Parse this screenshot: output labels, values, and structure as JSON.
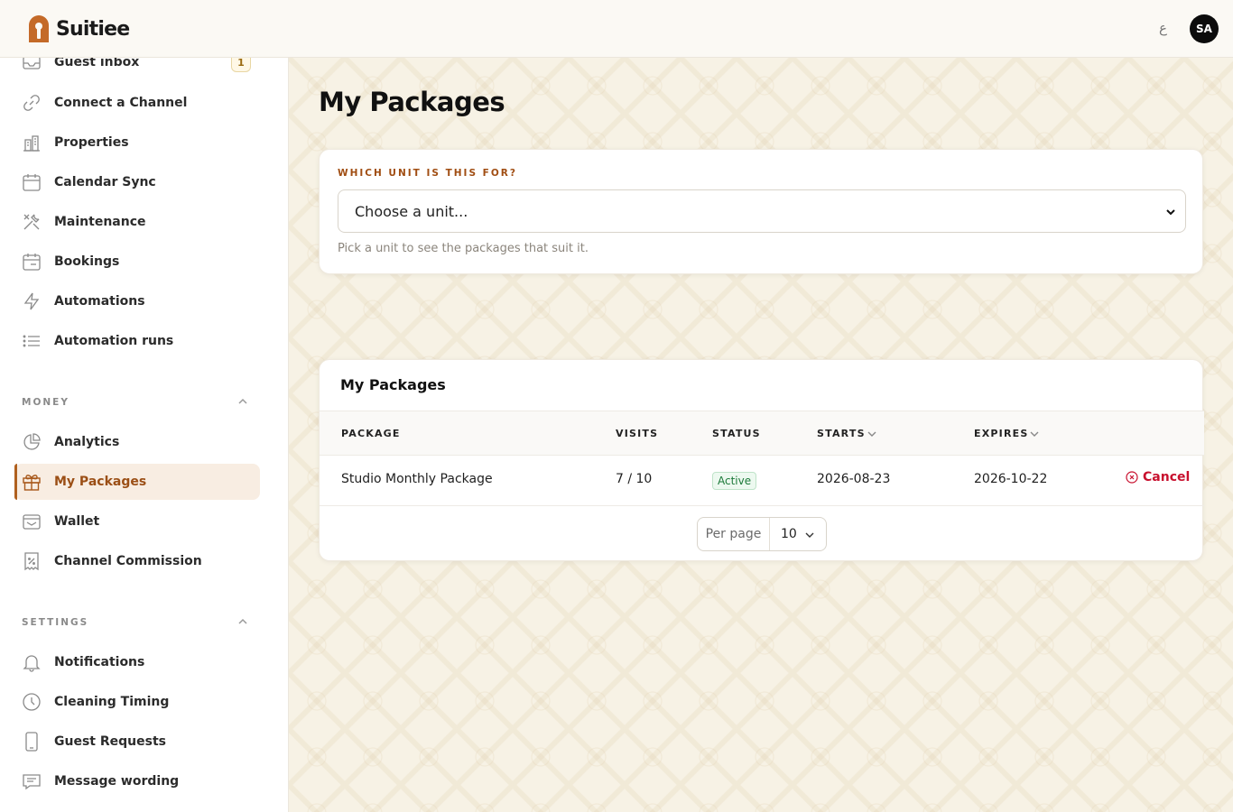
{
  "app": {
    "name": "Suitiee"
  },
  "header": {
    "lang_toggle": "ع",
    "avatar_initials": "SA"
  },
  "sidebar": {
    "items": [
      {
        "label": "Guest inbox",
        "icon": "inbox-icon",
        "badge": "1"
      },
      {
        "label": "Connect a Channel",
        "icon": "link-icon"
      },
      {
        "label": "Properties",
        "icon": "building-icon"
      },
      {
        "label": "Calendar Sync",
        "icon": "calendar-icon"
      },
      {
        "label": "Maintenance",
        "icon": "tools-icon"
      },
      {
        "label": "Bookings",
        "icon": "calendar-icon"
      },
      {
        "label": "Automations",
        "icon": "bolt-icon"
      },
      {
        "label": "Automation runs",
        "icon": "list-icon"
      }
    ],
    "money_section": {
      "title": "MONEY",
      "items": [
        {
          "label": "Analytics",
          "icon": "pie-chart-icon"
        },
        {
          "label": "My Packages",
          "icon": "gift-icon",
          "active": true
        },
        {
          "label": "Wallet",
          "icon": "wallet-icon"
        },
        {
          "label": "Channel Commission",
          "icon": "receipt-icon"
        }
      ]
    },
    "settings_section": {
      "title": "SETTINGS",
      "items": [
        {
          "label": "Notifications",
          "icon": "bell-icon"
        },
        {
          "label": "Cleaning Timing",
          "icon": "clock-icon"
        },
        {
          "label": "Guest Requests",
          "icon": "phone-icon"
        },
        {
          "label": "Message wording",
          "icon": "message-icon"
        }
      ]
    }
  },
  "main": {
    "page_title": "My Packages",
    "unit_picker": {
      "label": "WHICH UNIT IS THIS FOR?",
      "selected": "Choose a unit...",
      "hint": "Pick a unit to see the packages that suit it."
    },
    "packages": {
      "title": "My Packages",
      "columns": {
        "package": "PACKAGE",
        "visits": "VISITS",
        "status": "STATUS",
        "starts": "STARTS",
        "expires": "EXPIRES"
      },
      "rows": [
        {
          "package": "Studio Monthly Package",
          "visits": "7 / 10",
          "status": "Active",
          "starts": "2026-08-23",
          "expires": "2026-10-22",
          "action": "Cancel"
        }
      ],
      "pagination": {
        "per_page_label": "Per page",
        "per_page_value": "10"
      }
    }
  },
  "colors": {
    "accent": "#b0601e",
    "status_active": "#1d7a3a",
    "danger": "#c8102e"
  }
}
